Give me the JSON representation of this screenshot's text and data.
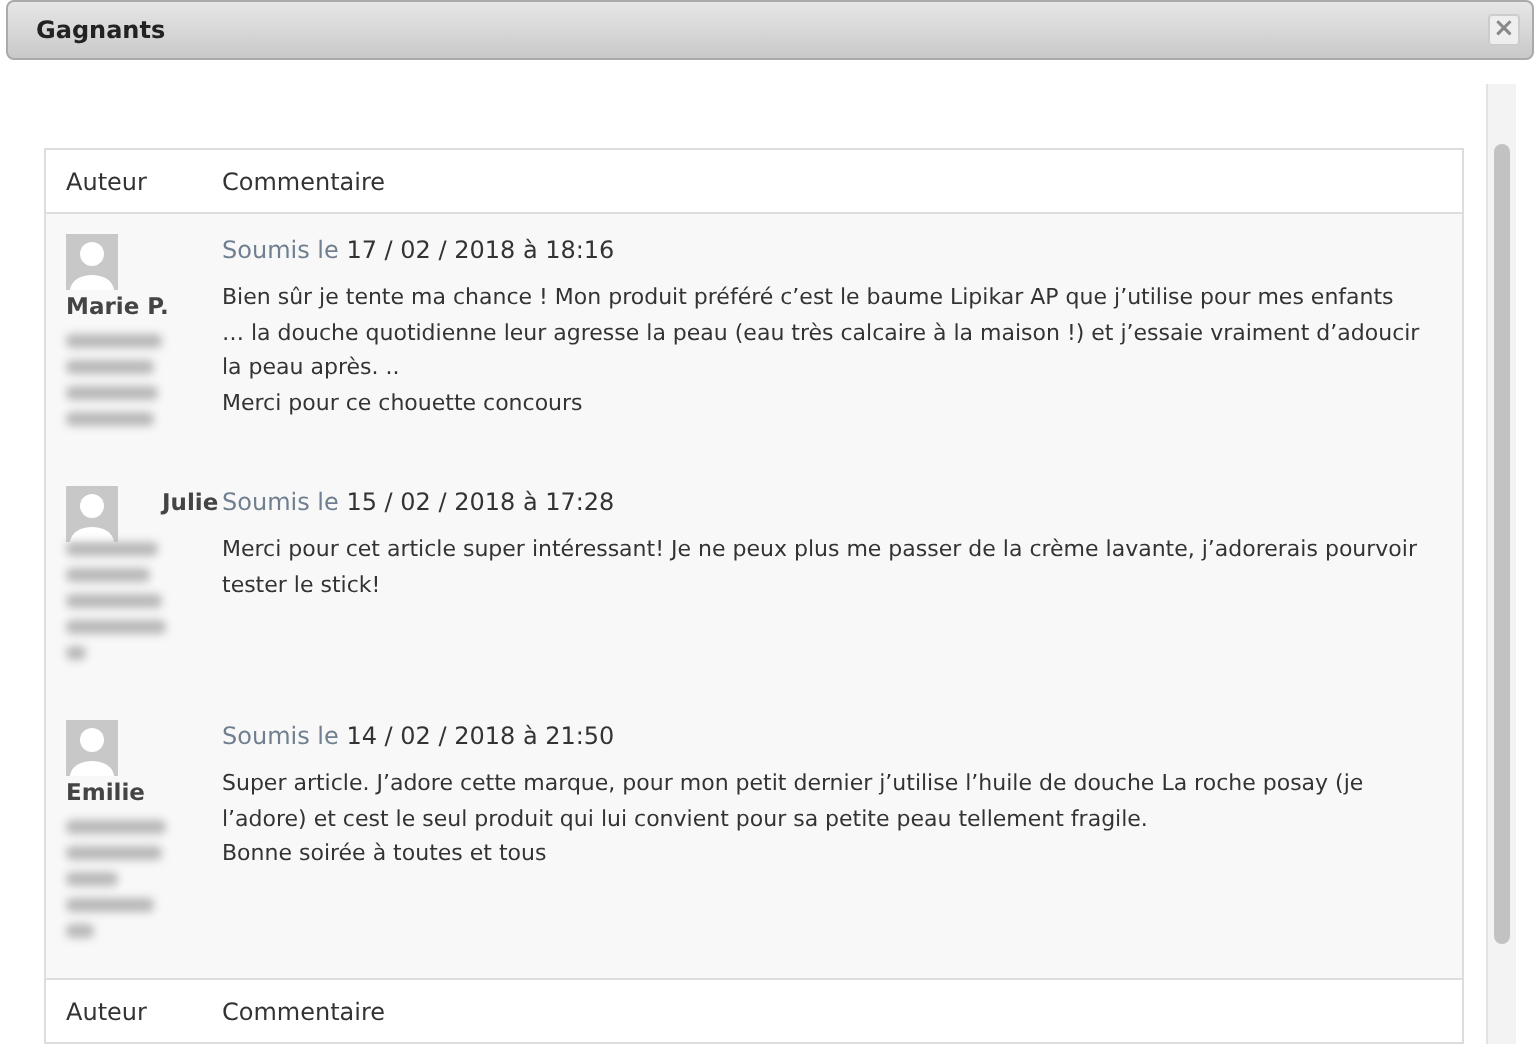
{
  "dialog": {
    "title": "Gagnants",
    "close": "×"
  },
  "table": {
    "columns": [
      "Auteur",
      "Commentaire"
    ],
    "rows": [
      {
        "author": "Marie P.",
        "submitted_label": "Soumis le",
        "date": "17 / 02 / 2018 à 18:16",
        "paragraphs": [
          "Bien sûr je tente ma chance ! Mon produit préféré c’est le baume Lipikar AP que j’utilise pour mes enfants … la douche quotidienne leur agresse la peau (eau très calcaire à la maison !) et j’essaie vraiment d’adoucir la peau après. ..",
          "Merci pour ce chouette concours"
        ]
      },
      {
        "author": "Julie",
        "submitted_label": "Soumis le",
        "date": "15 / 02 / 2018 à 17:28",
        "paragraphs": [
          "Merci pour cet article super intéressant! Je ne peux plus me passer de la crème lavante, j’adorerais pourvoir tester le stick!"
        ]
      },
      {
        "author": "Emilie",
        "submitted_label": "Soumis le",
        "date": "14 / 02 / 2018 à 21:50",
        "paragraphs": [
          "Super article. J’adore cette marque, pour mon petit dernier j’utilise l’huile de douche La roche posay (je l’adore) et cest le seul produit qui lui convient pour sa petite peau tellement fragile.",
          "Bonne soirée à toutes et tous"
        ]
      }
    ],
    "footer_columns": [
      "Auteur",
      "Commentaire"
    ]
  }
}
